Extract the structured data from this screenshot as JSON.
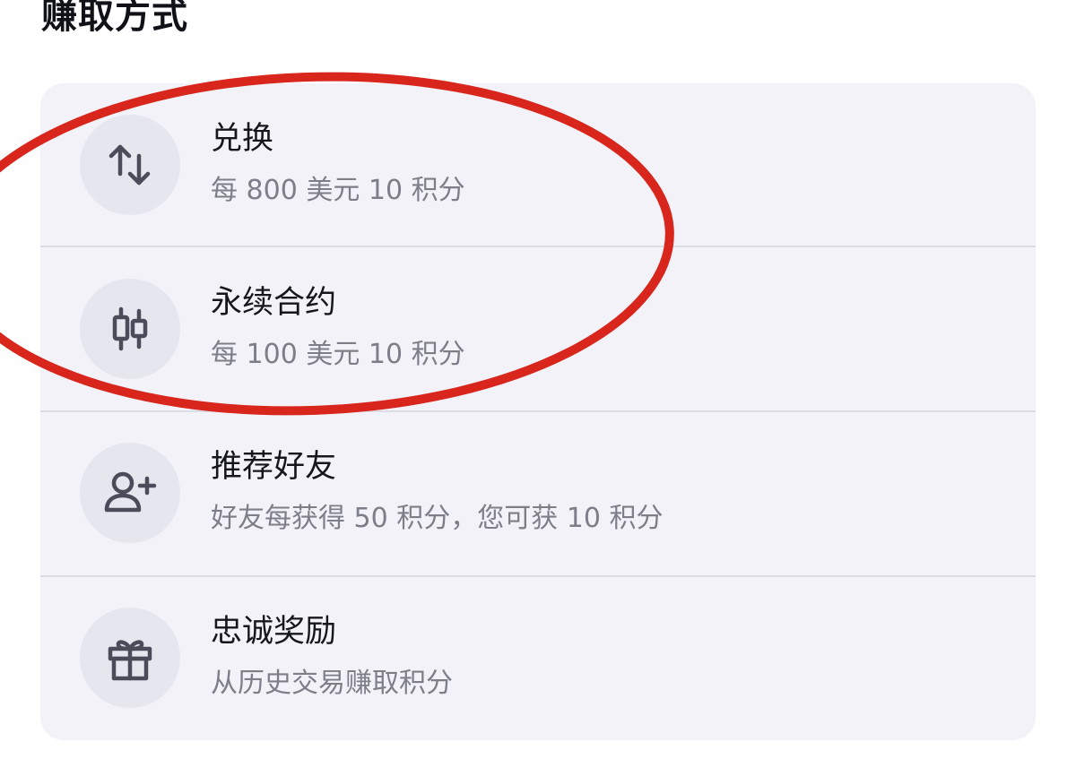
{
  "header": {
    "title": "赚取方式"
  },
  "items": [
    {
      "icon": "swap-arrows-icon",
      "title": "兑换",
      "subtitle": "每 800 美元 10 积分"
    },
    {
      "icon": "candlestick-icon",
      "title": "永续合约",
      "subtitle": "每 100 美元 10 积分"
    },
    {
      "icon": "add-user-icon",
      "title": "推荐好友",
      "subtitle": "好友每获得 50 积分，您可获 10 积分"
    },
    {
      "icon": "gift-icon",
      "title": "忠诚奖励",
      "subtitle": "从历史交易赚取积分"
    }
  ],
  "colors": {
    "card_background": "#f2f2f8",
    "icon_circle": "#e6e6ef",
    "icon_stroke": "#4a4c5a",
    "subtitle_text": "#7d7e88",
    "annotation_circle": "#d8261c"
  }
}
